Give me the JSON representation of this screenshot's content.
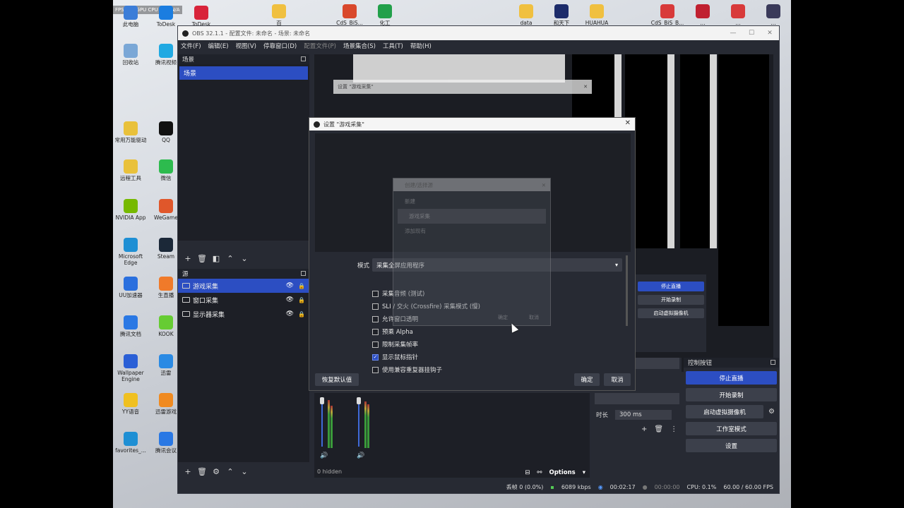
{
  "desktop": {
    "hud": "FPS N/A   GPU   CPU   延迟 N/A",
    "icons": [
      {
        "label": "此电脑",
        "color": "#3b7dd8"
      },
      {
        "label": "ToDesk",
        "color": "#1b7de0"
      },
      {
        "label": "ToDesk",
        "color": "#d8243a"
      },
      {
        "label": "回收站",
        "color": "#7aa7d6"
      },
      {
        "label": "腾讯视频",
        "color": "#20a9e2"
      },
      {
        "label": "常用万能驱动",
        "color": "#e9c13b"
      },
      {
        "label": "QQ",
        "color": "#111"
      },
      {
        "label": "远程工具",
        "color": "#e9c13b"
      },
      {
        "label": "微信",
        "color": "#2dbb4e"
      },
      {
        "label": "NVIDIA App",
        "color": "#76b900"
      },
      {
        "label": "WeGame",
        "color": "#e0572b"
      },
      {
        "label": "Microsoft Edge",
        "color": "#1e8fd4"
      },
      {
        "label": "Steam",
        "color": "#1b2838"
      },
      {
        "label": "UU加速器",
        "color": "#2a6fde"
      },
      {
        "label": "生直播",
        "color": "#f07a2a"
      },
      {
        "label": "腾讯文档",
        "color": "#2a78e4"
      },
      {
        "label": "KOOK",
        "color": "#66cc33"
      },
      {
        "label": "Wallpaper Engine",
        "color": "#2a5fd6"
      },
      {
        "label": "迅雷",
        "color": "#2a8ae4"
      },
      {
        "label": "YY语音",
        "color": "#f0c020"
      },
      {
        "label": "迅雷游戏",
        "color": "#f08a20"
      },
      {
        "label": "favorites_...",
        "color": "#1e8fd4"
      },
      {
        "label": "腾讯会议",
        "color": "#2a78e4"
      }
    ],
    "top_icons": [
      "百",
      "CdS_BiS...",
      "化工",
      "data",
      "和天下",
      "HUAHUA",
      "CdS_BiS_B...",
      "...",
      "...",
      "..."
    ]
  },
  "obs": {
    "title": "OBS 32.1.1 - 配置文件: 未命名 - 场景: 未命名",
    "menu": [
      "文件(F)",
      "编辑(E)",
      "视图(V)",
      "停靠窗口(D)",
      "配置文件(P)",
      "场景集合(S)",
      "工具(T)",
      "帮助(H)"
    ],
    "scenes_title": "场景",
    "scenes": [
      "场景"
    ],
    "sources_title": "源",
    "sources": [
      {
        "name": "游戏采集",
        "selected": true
      },
      {
        "name": "窗口采集",
        "selected": false
      },
      {
        "name": "显示器采集",
        "selected": false
      }
    ],
    "mixer_hidden": "0 hidden",
    "mixer_options": "Options",
    "transition_duration_label": "时长",
    "transition_duration": "300 ms",
    "controls_title": "控制按钮",
    "controls": [
      "停止直播",
      "开始录制",
      "启动虚拟摄像机",
      "工作室模式",
      "设置"
    ],
    "status": {
      "dropped": "丢帧 0 (0.0%)",
      "bitrate": "6089 kbps",
      "stream_time": "00:02:17",
      "rec_time": "00:00:00",
      "cpu": "CPU: 0.1%",
      "fps": "60.00 / 60.00 FPS"
    },
    "preview_controls": [
      "停止直播",
      "开始录制",
      "启动虚拟摄像机"
    ]
  },
  "dialog": {
    "back_title": "设置 \"游戏采集\"",
    "title": "设置 \"游戏采集\"",
    "mode_label": "模式",
    "mode_value": "采集全屏应用程序",
    "options": [
      {
        "label": "采集音频 (测试)",
        "checked": false
      },
      {
        "label": "SLI / 交火 (Crossfire) 采集模式 (慢)",
        "checked": false
      },
      {
        "label": "允许窗口透明",
        "checked": false
      },
      {
        "label": "预乘 Alpha",
        "checked": false
      },
      {
        "label": "限制采集帧率",
        "checked": false
      },
      {
        "label": "显示鼠标指针",
        "checked": true
      },
      {
        "label": "使用兼容重复器挂钩子",
        "checked": false
      }
    ],
    "reset_label": "恢复默认值",
    "ok_label": "确定",
    "cancel_label": "取消"
  },
  "ghost_dialog": {
    "title": "创建/选择源",
    "items": [
      "新建",
      "游戏采集",
      "添加现有"
    ],
    "ok": "确定",
    "cancel": "取消"
  }
}
